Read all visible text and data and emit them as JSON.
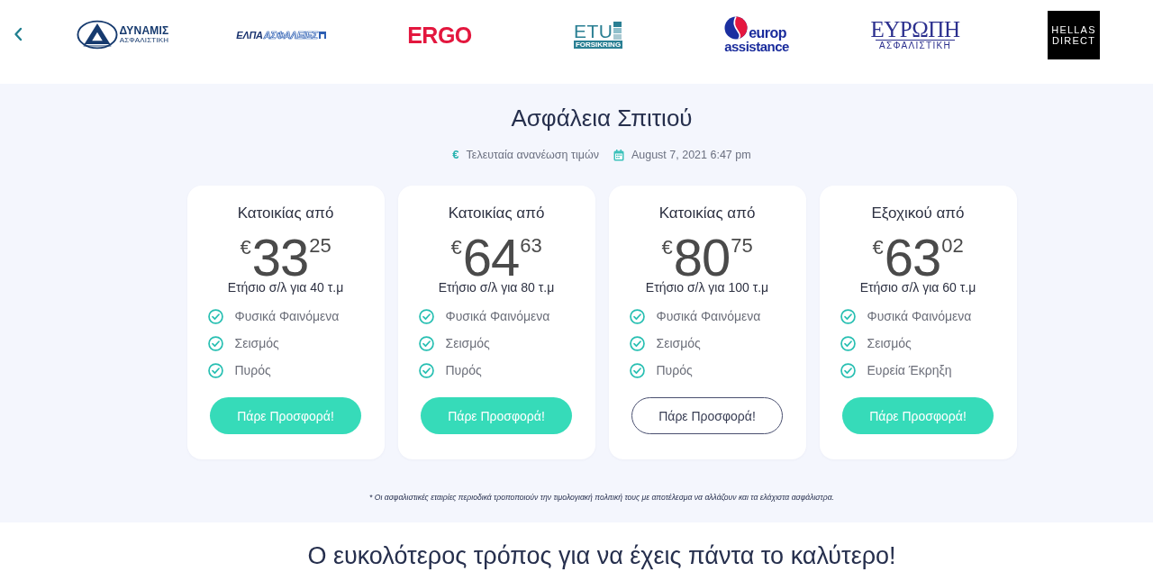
{
  "partner_carousel": {
    "logos": [
      {
        "kind": "dynamis",
        "lines": [
          "ΔΥΝΑΜΙΣ",
          "ΑΣΦΑΛΙΣΤΙΚΗ"
        ]
      },
      {
        "kind": "elpa",
        "lines": [
          "ΕΛΠΑ",
          "ΑΣΦΑΛΕΙΕΣ"
        ]
      },
      {
        "kind": "ergo",
        "lines": [
          "ERGO"
        ]
      },
      {
        "kind": "etu",
        "lines": [
          "ETU",
          "FORSIKRING"
        ]
      },
      {
        "kind": "europ",
        "lines": [
          "europ",
          "assistance"
        ]
      },
      {
        "kind": "evropi",
        "lines": [
          "ΕΥΡΩΠΗ",
          "ΑΣΦΑΛΙΣΤΙΚΗ"
        ]
      },
      {
        "kind": "hellas",
        "lines": [
          "HELLAS",
          "DIRECT"
        ]
      }
    ]
  },
  "hero": {
    "title": "Ασφάλεια Σπιτιού",
    "currency_symbol": "€",
    "updated_label": "Τελευταία ανανέωση τιμών",
    "updated_date": "August 7, 2021 6:47 pm"
  },
  "plans": [
    {
      "title": "Κατοικίας από",
      "currency": "€",
      "price_whole": "33",
      "price_cents": "25",
      "basis": "Ετήσιο σ/λ για 40 τ.μ",
      "features": [
        "Φυσικά Φαινόμενα",
        "Σεισμός",
        "Πυρός"
      ],
      "button": {
        "label": "Πάρε Προσφορά!",
        "kind": "solid"
      }
    },
    {
      "title": "Κατοικίας από",
      "currency": "€",
      "price_whole": "64",
      "price_cents": "63",
      "basis": "Ετήσιο σ/λ για 80 τ.μ",
      "features": [
        "Φυσικά Φαινόμενα",
        "Σεισμός",
        "Πυρός"
      ],
      "button": {
        "label": "Πάρε Προσφορά!",
        "kind": "solid"
      }
    },
    {
      "title": "Κατοικίας από",
      "currency": "€",
      "price_whole": "80",
      "price_cents": "75",
      "basis": "Ετήσιο σ/λ για 100 τ.μ",
      "features": [
        "Φυσικά Φαινόμενα",
        "Σεισμός",
        "Πυρός"
      ],
      "button": {
        "label": "Πάρε Προσφορά!",
        "kind": "outline"
      }
    },
    {
      "title": "Εξοχικού από",
      "currency": "€",
      "price_whole": "63",
      "price_cents": "02",
      "basis": "Ετήσιο σ/λ για 60 τ.μ",
      "features": [
        "Φυσικά Φαινόμενα",
        "Σεισμός",
        "Ευρεία Έκρηξη"
      ],
      "button": {
        "label": "Πάρε Προσφορά!",
        "kind": "solid"
      }
    }
  ],
  "footnote": "* Οι ασφαλιστικές εταιρίες περιοδικά τροποποιούν την τιμολογιακή πολιτική τους με αποτέλεσμα να αλλάζουν και τα ελάχιστα ασφάλιστρα.",
  "next_section": {
    "heading": "Ο ευκολότερος τρόπος για να έχεις πάντα το καλύτερο!"
  }
}
